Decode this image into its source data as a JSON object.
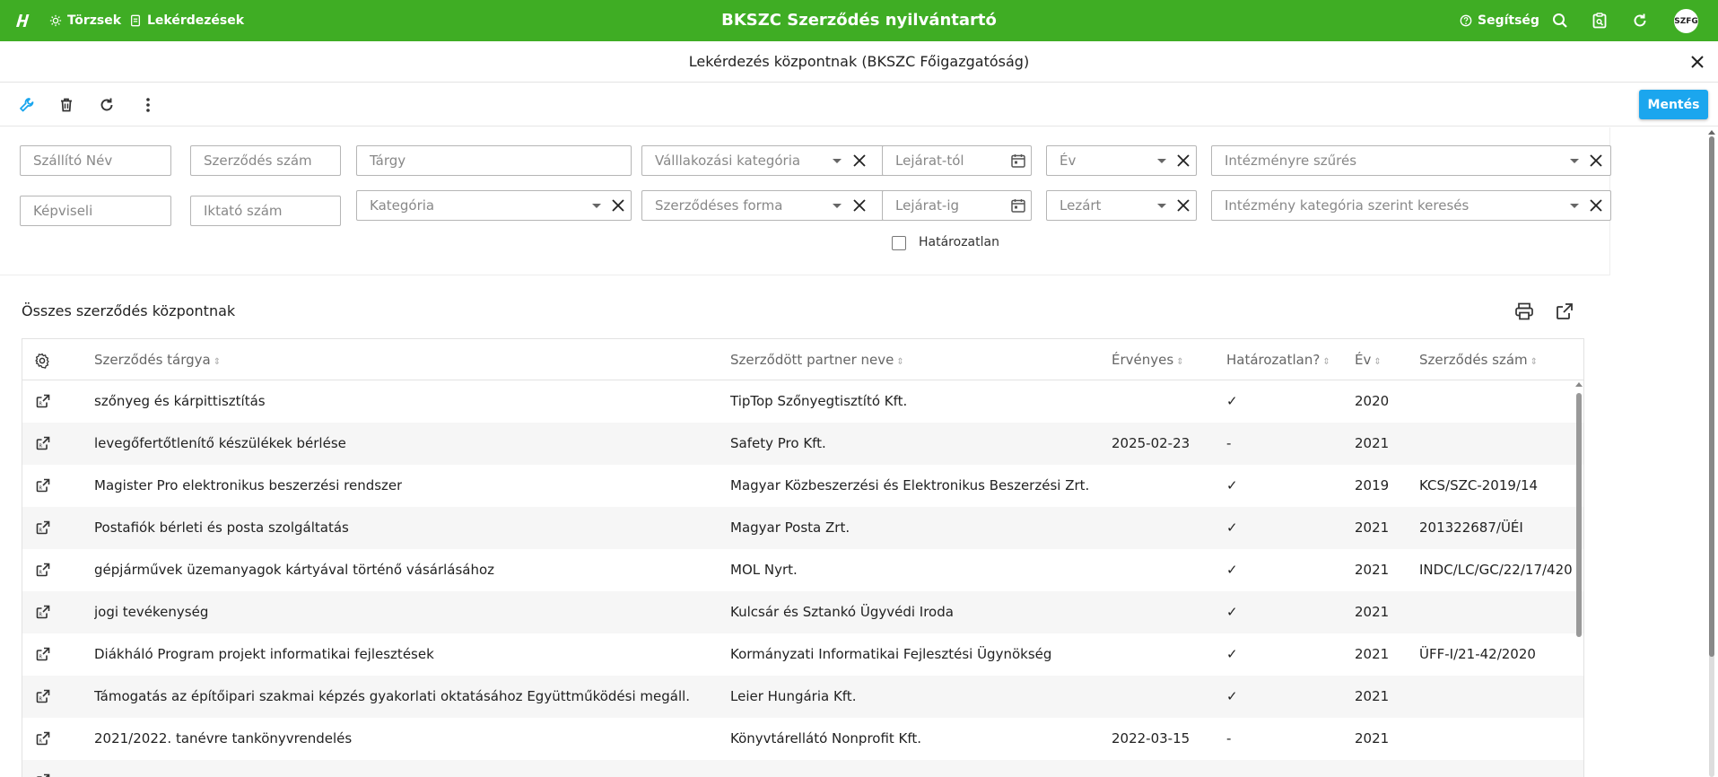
{
  "topbar": {
    "nav": [
      {
        "label": "Törzsek",
        "icon": "cog-sun-icon"
      },
      {
        "label": "Lekérdezések",
        "icon": "document-icon"
      }
    ],
    "title": "BKSZC Szerződés nyilvántartó",
    "help_label": "Segítség",
    "avatar_text": "SZFG"
  },
  "subheader": {
    "title": "Lekérdezés központnak (BKSZC Főigazgatóság)"
  },
  "toolbar": {
    "save_label": "Mentés"
  },
  "filters": {
    "szallito_nev": "Szállító Név",
    "szerzodes_szam": "Szerződés szám",
    "targy": "Tárgy",
    "vallalkozasi_kategoria": "Válllakozási kategória",
    "lejarat_tol": "Lejárat-tól",
    "ev": "Év",
    "intezmenyre_szures": "Intézményre szűrés",
    "kepviseli": "Képviseli",
    "iktato_szam": "Iktató szám",
    "kategoria": "Kategória",
    "szerzodeses_forma": "Szerződéses forma",
    "lejarat_ig": "Lejárat-ig",
    "lezart": "Lezárt",
    "intezmeny_kategoria": "Intézmény kategória szerint keresés",
    "hatarozatlan_label": "Határozatlan"
  },
  "card": {
    "title": "Összes szerződés központnak"
  },
  "table": {
    "columns": [
      "Szerződés tárgya",
      "Szerződött partner neve",
      "Érvényes",
      "Határozatlan?",
      "Év",
      "Szerződés szám"
    ],
    "rows": [
      {
        "targy": "szőnyeg és kárpittisztítás",
        "partner": "TipTop Szőnyegtisztító Kft.",
        "ervenyes": "",
        "hatarozatlan": "✓",
        "ev": "2020",
        "szam": ""
      },
      {
        "targy": "levegőfertőtlenítő készülékek bérlése",
        "partner": "Safety Pro Kft.",
        "ervenyes": "2025-02-23",
        "hatarozatlan": "-",
        "ev": "2021",
        "szam": ""
      },
      {
        "targy": "Magister Pro elektronikus beszerzési rendszer",
        "partner": "Magyar Közbeszerzési és Elektronikus Beszerzési Zrt.",
        "ervenyes": "",
        "hatarozatlan": "✓",
        "ev": "2019",
        "szam": "KCS/SZC-2019/14"
      },
      {
        "targy": "Postafiók bérleti és posta szolgáltatás",
        "partner": "Magyar Posta Zrt.",
        "ervenyes": "",
        "hatarozatlan": "✓",
        "ev": "2021",
        "szam": "201322687/ÜÉI"
      },
      {
        "targy": "gépjárművek üzemanyagok kártyával történő vásárlásához",
        "partner": "MOL Nyrt.",
        "ervenyes": "",
        "hatarozatlan": "✓",
        "ev": "2021",
        "szam": "INDC/LC/GC/22/17/420"
      },
      {
        "targy": "jogi tevékenység",
        "partner": "Kulcsár és Sztankó Ügyvédi Iroda",
        "ervenyes": "",
        "hatarozatlan": "✓",
        "ev": "2021",
        "szam": ""
      },
      {
        "targy": "Diákháló Program projekt informatikai fejlesztések",
        "partner": "Kormányzati Informatikai Fejlesztési Ügynökség",
        "ervenyes": "",
        "hatarozatlan": "✓",
        "ev": "2021",
        "szam": "ÜFF-I/21-42/2020"
      },
      {
        "targy": "Támogatás az építőipari szakmai képzés gyakorlati oktatásához Együttműködési megáll.",
        "partner": "Leier Hungária Kft.",
        "ervenyes": "",
        "hatarozatlan": "✓",
        "ev": "2021",
        "szam": ""
      },
      {
        "targy": "2021/2022. tanévre tankönyvrendelés",
        "partner": "Könyvtárellátó Nonprofit Kft.",
        "ervenyes": "2022-03-15",
        "hatarozatlan": "-",
        "ev": "2021",
        "szam": ""
      }
    ]
  }
}
